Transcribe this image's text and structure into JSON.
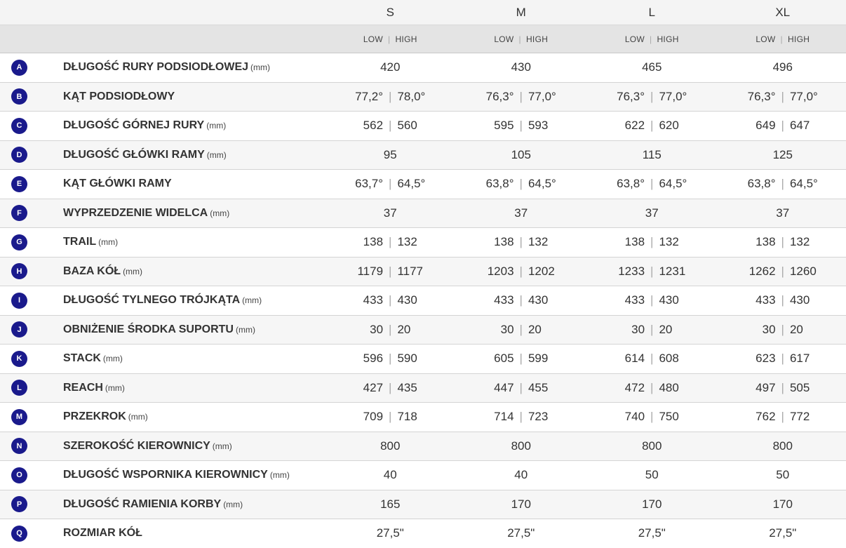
{
  "sizes": [
    "S",
    "M",
    "L",
    "XL"
  ],
  "low_label": "LOW",
  "high_label": "HIGH",
  "rows": [
    {
      "badge": "A",
      "label": "DŁUGOŚĆ RURY PODSIODŁOWEJ",
      "unit": "(mm)",
      "values": [
        [
          "420"
        ],
        [
          "430"
        ],
        [
          "465"
        ],
        [
          "496"
        ]
      ]
    },
    {
      "badge": "B",
      "label": "KĄT PODSIODŁOWY",
      "unit": "",
      "values": [
        [
          "77,2°",
          "78,0°"
        ],
        [
          "76,3°",
          "77,0°"
        ],
        [
          "76,3°",
          "77,0°"
        ],
        [
          "76,3°",
          "77,0°"
        ]
      ]
    },
    {
      "badge": "C",
      "label": "DŁUGOŚĆ GÓRNEJ RURY",
      "unit": "(mm)",
      "values": [
        [
          "562",
          "560"
        ],
        [
          "595",
          "593"
        ],
        [
          "622",
          "620"
        ],
        [
          "649",
          "647"
        ]
      ]
    },
    {
      "badge": "D",
      "label": "DŁUGOŚĆ GŁÓWKI RAMY",
      "unit": "(mm)",
      "values": [
        [
          "95"
        ],
        [
          "105"
        ],
        [
          "115"
        ],
        [
          "125"
        ]
      ]
    },
    {
      "badge": "E",
      "label": "KĄT GŁÓWKI RAMY",
      "unit": "",
      "values": [
        [
          "63,7°",
          "64,5°"
        ],
        [
          "63,8°",
          "64,5°"
        ],
        [
          "63,8°",
          "64,5°"
        ],
        [
          "63,8°",
          "64,5°"
        ]
      ]
    },
    {
      "badge": "F",
      "label": "WYPRZEDZENIE WIDELCA",
      "unit": "(mm)",
      "values": [
        [
          "37"
        ],
        [
          "37"
        ],
        [
          "37"
        ],
        [
          "37"
        ]
      ]
    },
    {
      "badge": "G",
      "label": "TRAIL",
      "unit": "(mm)",
      "values": [
        [
          "138",
          "132"
        ],
        [
          "138",
          "132"
        ],
        [
          "138",
          "132"
        ],
        [
          "138",
          "132"
        ]
      ]
    },
    {
      "badge": "H",
      "label": "BAZA KÓŁ",
      "unit": "(mm)",
      "values": [
        [
          "1179",
          "1177"
        ],
        [
          "1203",
          "1202"
        ],
        [
          "1233",
          "1231"
        ],
        [
          "1262",
          "1260"
        ]
      ]
    },
    {
      "badge": "I",
      "label": "DŁUGOŚĆ TYLNEGO TRÓJKĄTA",
      "unit": "(mm)",
      "values": [
        [
          "433",
          "430"
        ],
        [
          "433",
          "430"
        ],
        [
          "433",
          "430"
        ],
        [
          "433",
          "430"
        ]
      ]
    },
    {
      "badge": "J",
      "label": "OBNIŻENIE ŚRODKA SUPORTU",
      "unit": "(mm)",
      "values": [
        [
          "30",
          "20"
        ],
        [
          "30",
          "20"
        ],
        [
          "30",
          "20"
        ],
        [
          "30",
          "20"
        ]
      ]
    },
    {
      "badge": "K",
      "label": "STACK",
      "unit": "(mm)",
      "values": [
        [
          "596",
          "590"
        ],
        [
          "605",
          "599"
        ],
        [
          "614",
          "608"
        ],
        [
          "623",
          "617"
        ]
      ]
    },
    {
      "badge": "L",
      "label": "REACH",
      "unit": "(mm)",
      "values": [
        [
          "427",
          "435"
        ],
        [
          "447",
          "455"
        ],
        [
          "472",
          "480"
        ],
        [
          "497",
          "505"
        ]
      ]
    },
    {
      "badge": "M",
      "label": "PRZEKROK",
      "unit": "(mm)",
      "values": [
        [
          "709",
          "718"
        ],
        [
          "714",
          "723"
        ],
        [
          "740",
          "750"
        ],
        [
          "762",
          "772"
        ]
      ]
    },
    {
      "badge": "N",
      "label": "SZEROKOŚĆ KIEROWNICY",
      "unit": "(mm)",
      "values": [
        [
          "800"
        ],
        [
          "800"
        ],
        [
          "800"
        ],
        [
          "800"
        ]
      ]
    },
    {
      "badge": "O",
      "label": "DŁUGOŚĆ WSPORNIKA KIEROWNICY",
      "unit": "(mm)",
      "values": [
        [
          "40"
        ],
        [
          "40"
        ],
        [
          "50"
        ],
        [
          "50"
        ]
      ]
    },
    {
      "badge": "P",
      "label": "DŁUGOŚĆ RAMIENIA KORBY",
      "unit": "(mm)",
      "values": [
        [
          "165"
        ],
        [
          "170"
        ],
        [
          "170"
        ],
        [
          "170"
        ]
      ]
    },
    {
      "badge": "Q",
      "label": "ROZMIAR KÓŁ",
      "unit": "",
      "values": [
        [
          "27,5\""
        ],
        [
          "27,5\""
        ],
        [
          "27,5\""
        ],
        [
          "27,5\""
        ]
      ]
    }
  ],
  "colors": {
    "badge": "#1a1a8c",
    "header_bg": "#e4e4e4",
    "size_bg": "#f4f4f4"
  }
}
